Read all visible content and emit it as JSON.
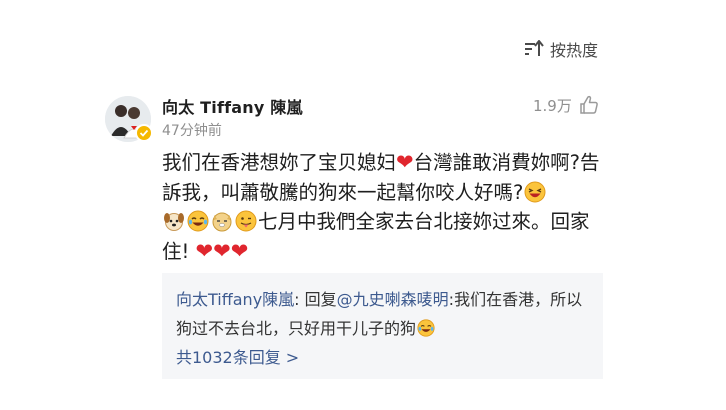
{
  "sort": {
    "label": "按热度",
    "icon": "sort-icon"
  },
  "comment": {
    "user_name": "向太 Tiffany 陳嵐",
    "verified": true,
    "time": "47分钟前",
    "likes": "1.9万",
    "text": {
      "p1": "我们在香港想妳了宝贝媳妇",
      "p2": "台灣誰敢消費妳啊?告訴我，叫蕭敬騰的狗來一起幫你咬人好嗎?",
      "p3": "七月中我們全家去台北接妳过來。回家住!",
      "hearts": "❤❤❤",
      "heart": "❤"
    },
    "emojis": [
      "laugh-emoji",
      "dog-emoji",
      "laugh-tears-emoji",
      "doge-emoji",
      "tongue-emoji"
    ]
  },
  "reply": {
    "user": "向太Tiffany陳嵐",
    "prefix": ": 回复",
    "mention": "@九史喇森唛明",
    "text": ":我们在香港，所以狗过不去台北，只好用干儿子的狗",
    "count_label": "共1032条回复 >"
  },
  "colors": {
    "link": "#3d5a8f",
    "heart": "#e0262e",
    "badge": "#f5b800",
    "reply_bg": "#f5f6f8"
  }
}
